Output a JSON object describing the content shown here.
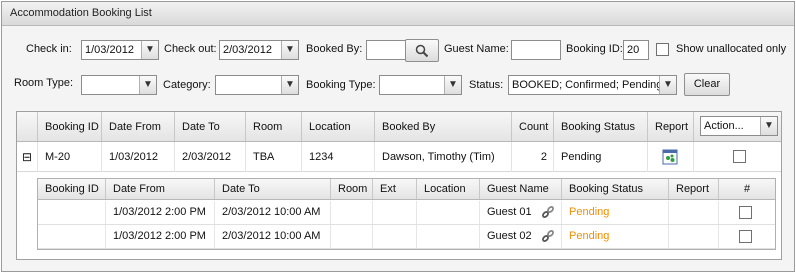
{
  "panel": {
    "title": "Accommodation Booking List"
  },
  "filters": {
    "check_in_label": "Check in:",
    "check_in_value": "1/03/2012",
    "check_out_label": "Check out:",
    "check_out_value": "2/03/2012",
    "booked_by_label": "Booked By:",
    "booked_by_value": "",
    "guest_name_label": "Guest Name:",
    "guest_name_value": "",
    "booking_id_label": "Booking ID:",
    "booking_id_value": "20",
    "show_unallocated_label": "Show unallocated only",
    "show_unallocated_checked": false,
    "room_type_label": "Room Type:",
    "room_type_value": "",
    "category_label": "Category:",
    "category_value": "",
    "booking_type_label": "Booking Type:",
    "booking_type_value": "",
    "status_label": "Status:",
    "status_value": "BOOKED; Confirmed; Pending;",
    "clear_label": "Clear"
  },
  "grid": {
    "columns": [
      "Booking ID",
      "Date From",
      "Date To",
      "Room",
      "Location",
      "Booked By",
      "Count",
      "Booking Status",
      "Report"
    ],
    "action_value": "Action...",
    "expand_glyph": "⊟",
    "row": {
      "booking_id": "M-20",
      "date_from": "1/03/2012",
      "date_to": "2/03/2012",
      "room": "TBA",
      "location": "1234",
      "booked_by": "Dawson, Timothy (Tim)",
      "count": "2",
      "booking_status": "Pending"
    }
  },
  "subgrid": {
    "columns": [
      "Booking ID",
      "Date From",
      "Date To",
      "Room",
      "Ext",
      "Location",
      "Guest Name",
      "Booking Status",
      "Report",
      "#"
    ],
    "rows": [
      {
        "booking_id": "",
        "date_from": "1/03/2012 2:00 PM",
        "date_to": "2/03/2012 10:00 AM",
        "room": "",
        "ext": "",
        "location": "",
        "guest_name": "Guest 01",
        "booking_status": "Pending"
      },
      {
        "booking_id": "",
        "date_from": "1/03/2012 2:00 PM",
        "date_to": "2/03/2012 10:00 AM",
        "room": "",
        "ext": "",
        "location": "",
        "guest_name": "Guest 02",
        "booking_status": "Pending"
      }
    ]
  },
  "colors": {
    "pending": "#e8920a",
    "panel_bg": "#f4f4f4",
    "border": "#9a9a9a"
  },
  "icons": [
    "search-icon",
    "dropdown-arrow-icon",
    "collapse-icon",
    "report-icon",
    "link-icon"
  ]
}
